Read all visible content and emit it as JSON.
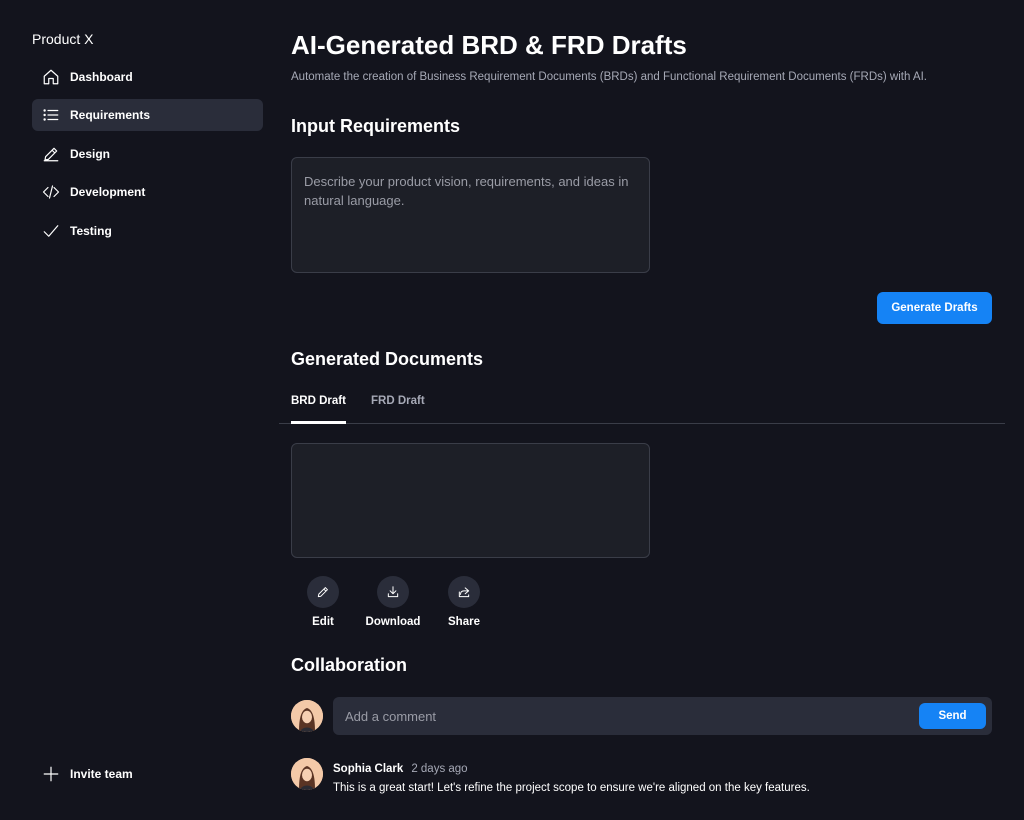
{
  "sidebar": {
    "app_title": "Product X",
    "items": [
      {
        "label": "Dashboard",
        "icon": "home-icon"
      },
      {
        "label": "Requirements",
        "icon": "list-icon",
        "active": true
      },
      {
        "label": "Design",
        "icon": "pencil-icon"
      },
      {
        "label": "Development",
        "icon": "code-icon"
      },
      {
        "label": "Testing",
        "icon": "check-icon"
      }
    ],
    "invite_label": "Invite team"
  },
  "header": {
    "title": "AI-Generated BRD & FRD Drafts",
    "subtitle": "Automate the creation of Business Requirement Documents (BRDs) and Functional Requirement Documents (FRDs) with AI."
  },
  "input_section": {
    "title": "Input Requirements",
    "placeholder": "Describe your product vision, requirements, and ideas in natural language.",
    "value": "",
    "generate_label": "Generate Drafts"
  },
  "documents": {
    "title": "Generated Documents",
    "tabs": [
      {
        "label": "BRD Draft",
        "active": true
      },
      {
        "label": "FRD Draft",
        "active": false
      }
    ],
    "content": "",
    "actions": [
      {
        "label": "Edit",
        "icon": "pencil-icon"
      },
      {
        "label": "Download",
        "icon": "download-icon"
      },
      {
        "label": "Share",
        "icon": "share-icon"
      }
    ]
  },
  "collaboration": {
    "title": "Collaboration",
    "comment_placeholder": "Add a comment",
    "send_label": "Send",
    "comments": [
      {
        "author": "Sophia Clark",
        "time": "2 days ago",
        "text": "This is a great start! Let's refine the project scope to ensure we're aligned on the key features."
      }
    ]
  },
  "colors": {
    "background": "#13141d",
    "accent": "#1583f5",
    "surface": "#1d1f27",
    "active_nav": "#2a2d3a"
  }
}
